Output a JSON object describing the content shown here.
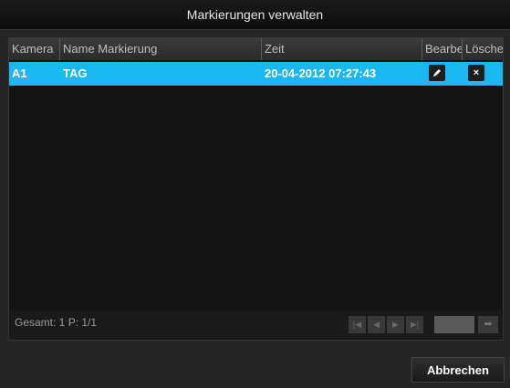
{
  "dialog": {
    "title": "Markierungen verwalten"
  },
  "table": {
    "headers": {
      "camera": "Kamera",
      "name": "Name Markierung",
      "time": "Zeit",
      "edit": "Bearbeiten",
      "delete": "Löschen"
    },
    "rows": [
      {
        "camera": "A1",
        "name": "TAG",
        "time": "20-04-2012 07:27:43"
      }
    ]
  },
  "footer": {
    "total": "Gesamt: 1 P: 1/1",
    "page_value": ""
  },
  "pager": {
    "first": "|◀",
    "prev": "◀",
    "next": "▶",
    "last": "▶|",
    "go": "➡"
  },
  "buttons": {
    "cancel": "Abbrechen"
  },
  "colors": {
    "selected_row": "#19b8f2",
    "background": "#141414"
  },
  "icons": {
    "edit": "pencil-icon",
    "delete": "close-icon"
  }
}
